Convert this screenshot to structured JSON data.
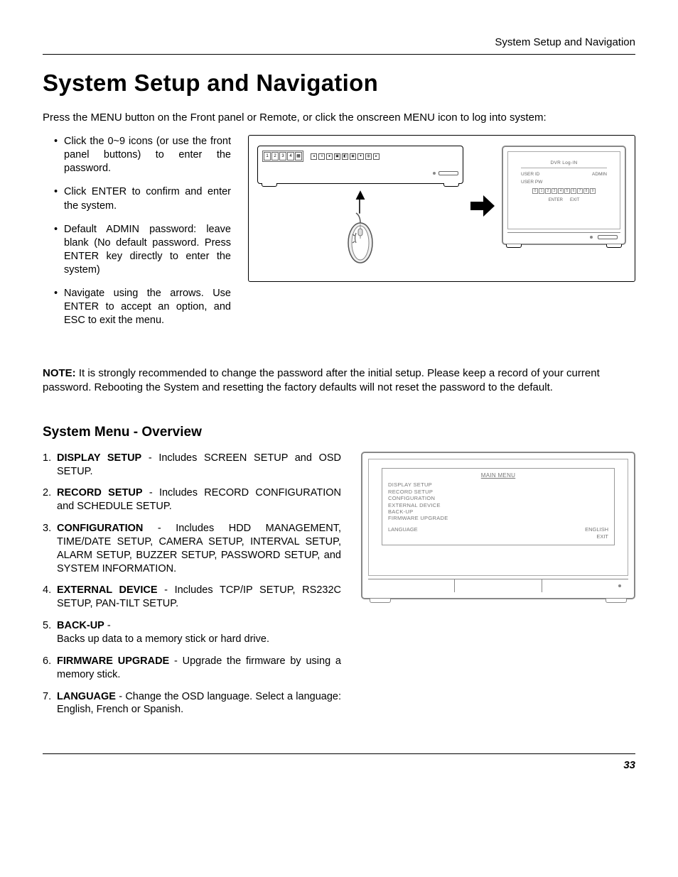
{
  "header": {
    "running_head": "System Setup and Navigation"
  },
  "title": "System Setup and Navigation",
  "intro": "Press the MENU button on the Front panel or Remote, or click the onscreen MENU icon to log into system:",
  "bullets": [
    "Click the 0~9 icons (or use the front panel buttons) to enter the password.",
    "Click ENTER to confirm and enter the system.",
    "Default ADMIN password: leave blank (No default password. Press ENTER key directly to enter the system)",
    "Navigate using the arrows. Use ENTER to accept an option, and ESC to exit the menu."
  ],
  "diagram1": {
    "toolbar_numbers": [
      "1",
      "2",
      "3",
      "4"
    ],
    "login_title": "DVR Log-IN",
    "user_id_label": "USER ID",
    "user_pw_label": "USER PW",
    "user_id_value": "ADMIN",
    "digits": [
      "0",
      "1",
      "2",
      "3",
      "4",
      "5",
      "6",
      "7",
      "8",
      "9"
    ],
    "enter_label": "ENTER",
    "exit_label": "EXIT"
  },
  "note_label": "NOTE:",
  "note_text": " It is strongly recommended to change the password after the initial setup. Please keep a record of your current password. Rebooting the System and resetting the factory defaults will not reset the password to the default.",
  "subheading": "System Menu - Overview",
  "menu_items": [
    {
      "num": "1.",
      "name": "DISPLAY SETUP",
      "desc": " - Includes SCREEN SETUP and OSD SETUP."
    },
    {
      "num": "2.",
      "name": "RECORD SETUP",
      "desc": " - Includes RECORD CONFIGURATION and SCHEDULE SETUP."
    },
    {
      "num": "3.",
      "name": "CONFIGURATION",
      "desc": " - Includes HDD MANAGEMENT, TIME/DATE SETUP, CAMERA SETUP, INTERVAL SETUP, ALARM SETUP, BUZZER SETUP, PASSWORD SETUP, and SYSTEM INFORMATION."
    },
    {
      "num": "4.",
      "name": "EXTERNAL DEVICE",
      "desc": " - Includes TCP/IP SETUP, RS232C SETUP, PAN-TILT SETUP."
    },
    {
      "num": "5.",
      "name": "BACK-UP",
      "desc": "  -",
      "desc2": "Backs up data to a memory stick or hard drive."
    },
    {
      "num": "6.",
      "name": "FIRMWARE UPGRADE",
      "desc": " - Upgrade the firmware by using a memory stick."
    },
    {
      "num": "7.",
      "name": "LANGUAGE",
      "desc": " - Change the OSD language. Select a language: English, French or Spanish."
    }
  ],
  "diagram2": {
    "title": "MAIN MENU",
    "items": [
      "DISPLAY SETUP",
      "RECORD SETUP",
      "CONFIGURATION",
      "EXTERNAL DEVICE",
      "BACK-UP",
      "FIRMWARE UPGRADE"
    ],
    "language_label": "LANGUAGE",
    "language_value": "ENGLISH",
    "exit_label": "EXIT"
  },
  "page_number": "33"
}
